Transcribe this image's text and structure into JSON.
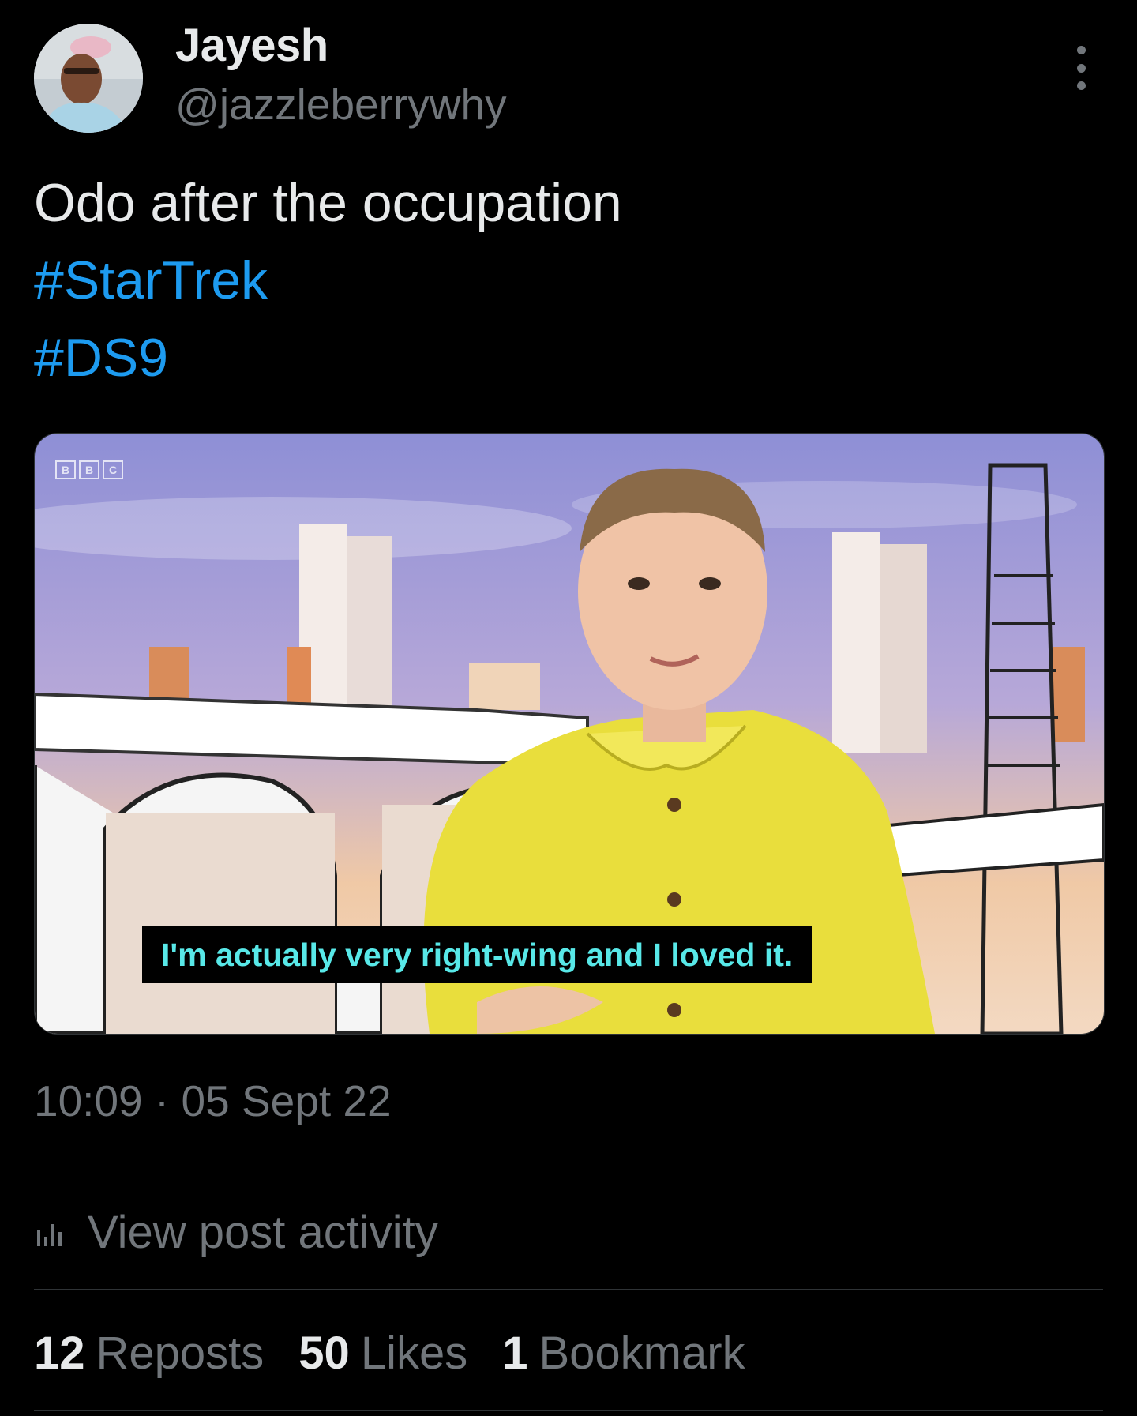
{
  "author": {
    "name": "Jayesh",
    "handle": "@jazzleberrywhy"
  },
  "post": {
    "text": "Odo after the occupation",
    "hashtags": [
      "#StarTrek",
      "#DS9"
    ],
    "media": {
      "logo_letters": [
        "B",
        "B",
        "C"
      ],
      "caption": "I'm actually very right-wing and I loved it."
    },
    "time": "10:09",
    "separator": "·",
    "date": "05 Sept 22"
  },
  "activity": {
    "label": "View post activity",
    "icon": "bar-chart-icon"
  },
  "stats": {
    "reposts_count": "12",
    "reposts_label": "Reposts",
    "likes_count": "50",
    "likes_label": "Likes",
    "bookmarks_count": "1",
    "bookmarks_label": "Bookmark"
  },
  "colors": {
    "background": "#000000",
    "text": "#e7e9ea",
    "secondary": "#71767b",
    "hashtag": "#1d9bf0",
    "caption": "#58e8e8",
    "divider": "#2f3336"
  }
}
